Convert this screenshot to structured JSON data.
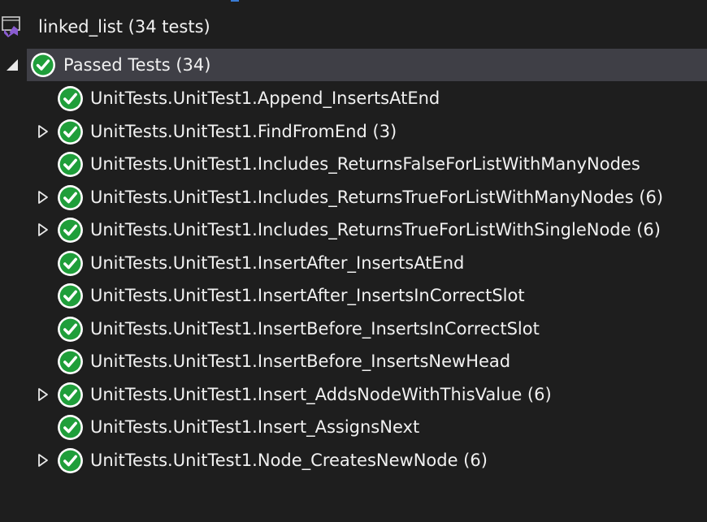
{
  "project": {
    "label": "linked_list (34 tests)",
    "icon": "visual-studio-project-icon"
  },
  "group": {
    "label": "Passed Tests (34)",
    "status": "passed",
    "expanded": true
  },
  "colors": {
    "background": "#1e1e1e",
    "selection": "#3f3f46",
    "pass_green": "#1f9e3a",
    "text": "#f1f1f1"
  },
  "tests": [
    {
      "label": "UnitTests.UnitTest1.Append_InsertsAtEnd",
      "expandable": false
    },
    {
      "label": "UnitTests.UnitTest1.FindFromEnd (3)",
      "expandable": true
    },
    {
      "label": "UnitTests.UnitTest1.Includes_ReturnsFalseForListWithManyNodes",
      "expandable": false
    },
    {
      "label": "UnitTests.UnitTest1.Includes_ReturnsTrueForListWithManyNodes (6)",
      "expandable": true
    },
    {
      "label": "UnitTests.UnitTest1.Includes_ReturnsTrueForListWithSingleNode (6)",
      "expandable": true
    },
    {
      "label": "UnitTests.UnitTest1.InsertAfter_InsertsAtEnd",
      "expandable": false
    },
    {
      "label": "UnitTests.UnitTest1.InsertAfter_InsertsInCorrectSlot",
      "expandable": false
    },
    {
      "label": "UnitTests.UnitTest1.InsertBefore_InsertsInCorrectSlot",
      "expandable": false
    },
    {
      "label": "UnitTests.UnitTest1.InsertBefore_InsertsNewHead",
      "expandable": false
    },
    {
      "label": "UnitTests.UnitTest1.Insert_AddsNodeWithThisValue (6)",
      "expandable": true
    },
    {
      "label": "UnitTests.UnitTest1.Insert_AssignsNext",
      "expandable": false
    },
    {
      "label": "UnitTests.UnitTest1.Node_CreatesNewNode (6)",
      "expandable": true
    }
  ]
}
